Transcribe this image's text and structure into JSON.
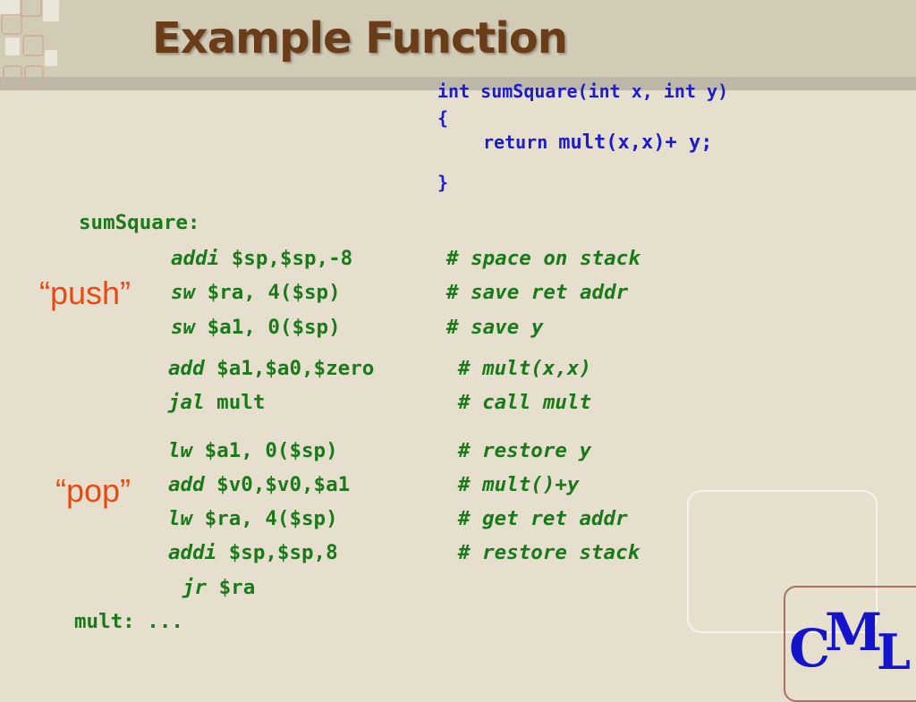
{
  "slide": {
    "title": "Example Function",
    "colors": {
      "background": "#e6dfcd",
      "title": "#6a3c18",
      "c_code": "#1c1ccf",
      "assembly": "#1a7a1a",
      "marker": "#e84a12",
      "logo": "#1414cc"
    }
  },
  "c_code": {
    "line1": "int sumSquare(int x, int y)",
    "line2": "{",
    "line3_keyword": "return",
    "line3_expr": "mult(x,x)+ y;",
    "line4": "}"
  },
  "assembly": {
    "label": "sumSquare:",
    "push_block": [
      {
        "op": "addi",
        "operands": " $sp,$sp,-8",
        "comment": "# space on stack"
      },
      {
        "op": "sw",
        "operands": " $ra, 4($sp)",
        "comment": "# save ret addr"
      },
      {
        "op": "sw",
        "operands": " $a1, 0($sp)",
        "comment": "# save y"
      }
    ],
    "call_block": [
      {
        "op": "add",
        "operands": " $a1,$a0,$zero",
        "comment": "# mult(x,x)"
      },
      {
        "op": "jal",
        "operands": " mult",
        "comment": "# call mult"
      }
    ],
    "pop_block": [
      {
        "op": "lw",
        "operands": " $a1, 0($sp)",
        "comment": "# restore y"
      },
      {
        "op": "add",
        "operands": " $v0,$v0,$a1",
        "comment": "# mult()+y"
      },
      {
        "op": "lw",
        "operands": " $ra, 4($sp)",
        "comment": "# get ret addr"
      },
      {
        "op": "addi",
        "operands": " $sp,$sp,8",
        "comment": "# restore stack"
      }
    ],
    "return": {
      "op": "jr",
      "operands": " $ra"
    },
    "mult_line": "mult: ..."
  },
  "markers": {
    "push": "“push”",
    "pop": "“pop”"
  },
  "logo": {
    "c": "C",
    "m": "M",
    "l": "L"
  }
}
